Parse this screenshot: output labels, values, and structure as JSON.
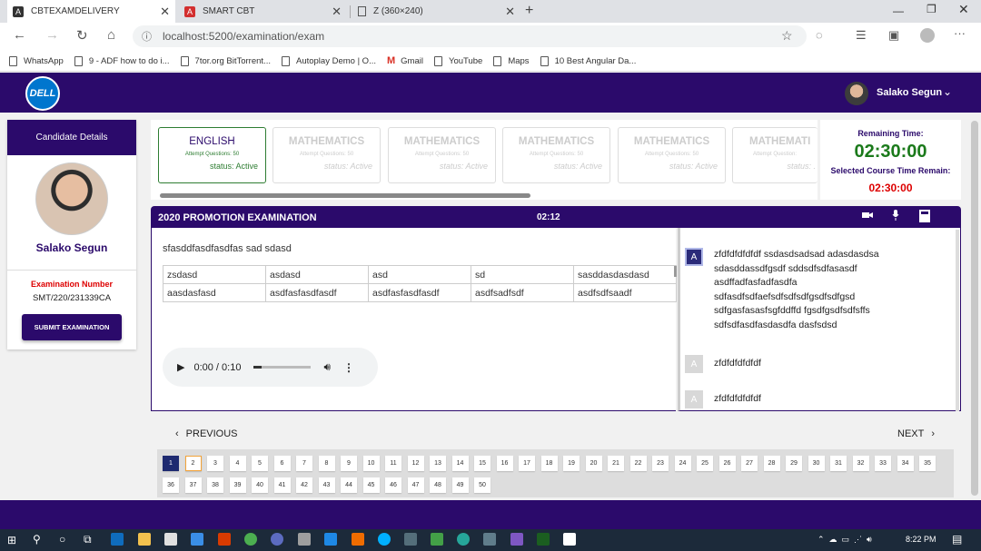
{
  "browser": {
    "tabs": [
      {
        "title": "CBTEXAMDELIVERY",
        "icon": "angular-icon"
      },
      {
        "title": "SMART CBT",
        "icon": "angular-icon"
      },
      {
        "title": "Z (360×240)",
        "icon": "page-icon"
      }
    ],
    "new_tab": "+",
    "url": "localhost:5200/examination/exam",
    "bookmarks": [
      "WhatsApp",
      "9 - ADF how to do i...",
      "7tor.org BitTorrent...",
      "Autoplay Demo | O...",
      "Gmail",
      "YouTube",
      "Maps",
      "10 Best Angular Da..."
    ]
  },
  "header": {
    "logo": "DELL",
    "user_name": "Salako Segun",
    "chevron": "⌄"
  },
  "candidate": {
    "title": "Candidate Details",
    "name": "Salako Segun",
    "exam_number_label": "Examination Number",
    "exam_number": "SMT/220/231339CA",
    "submit_label": "SUBMIT EXAMINATION"
  },
  "subjects": [
    {
      "name": "ENGLISH",
      "attempt": "Attempt Questions: 50",
      "status": "status: Active",
      "active": true
    },
    {
      "name": "MATHEMATICS",
      "attempt": "Attempt Questions: 50",
      "status": "status: Active",
      "active": false
    },
    {
      "name": "MATHEMATICS",
      "attempt": "Attempt Questions: 50",
      "status": "status: Active",
      "active": false
    },
    {
      "name": "MATHEMATICS",
      "attempt": "Attempt Questions: 50",
      "status": "status: Active",
      "active": false
    },
    {
      "name": "MATHEMATICS",
      "attempt": "Attempt Questions: 50",
      "status": "status: Active",
      "active": false
    },
    {
      "name": "MATHEMATI",
      "attempt": "Attempt Question:",
      "status": "status: .",
      "active": false
    }
  ],
  "timer": {
    "remaining_label": "Remaining Time:",
    "remaining": "02:30:00",
    "course_label": "Selected Course Time Remain:",
    "course_remaining": "02:30:00"
  },
  "exam": {
    "title": "2020 PROMOTION EXAMINATION",
    "elapsed": "02:12",
    "question": "sfasddfasdfasdfas sad sdasd",
    "table": [
      [
        "zsdasd",
        "asdasd",
        "asd",
        "sd",
        "sasddasdasdasd"
      ],
      [
        "aasdasfasd",
        "asdfasfasdfasdf",
        "asdfasfasdfasdf",
        "asdfsadfsdf",
        "asdfsdfsaadf"
      ]
    ],
    "audio_time": "0:00 / 0:10",
    "options": [
      {
        "badge": "A",
        "text": "zfdfdfdfdfdf ssdasdsadsad adasdasdsa sdasddassdfgsdf sddsdfsdfasasdf asdffadfasfadfasdfa sdfasdfsdfaefsdfsdfsdfgsdfsdfgsd sdfgasfasasfsgfddffd fgsdfgsdfsdfsffs sdfsdfasdfasdasdfa dasfsdsd",
        "selected": true
      },
      {
        "badge": "A",
        "text": "zfdfdfdfdfdf",
        "selected": false
      },
      {
        "badge": "A",
        "text": "zfdfdfdfdfdf",
        "selected": false
      }
    ]
  },
  "navigation": {
    "previous": "PREVIOUS",
    "next": "NEXT",
    "pages": [
      "1",
      "2",
      "3",
      "4",
      "5",
      "6",
      "7",
      "8",
      "9",
      "10",
      "11",
      "12",
      "13",
      "14",
      "15",
      "16",
      "17",
      "18",
      "19",
      "20",
      "21",
      "22",
      "23",
      "24",
      "25",
      "26",
      "27",
      "28",
      "29",
      "30",
      "31",
      "32",
      "33",
      "34",
      "35",
      "36",
      "37",
      "38",
      "39",
      "40",
      "41",
      "42",
      "43",
      "44",
      "45",
      "46",
      "47",
      "48",
      "49",
      "50"
    ],
    "current_page": 1,
    "visited_page": 2
  },
  "taskbar": {
    "clock": "8:22 PM"
  },
  "colors": {
    "brand": "#2b0a6b",
    "timer_green": "#1b7a1b",
    "alert_red": "#dd0000",
    "active_green": "#2e7d32"
  }
}
